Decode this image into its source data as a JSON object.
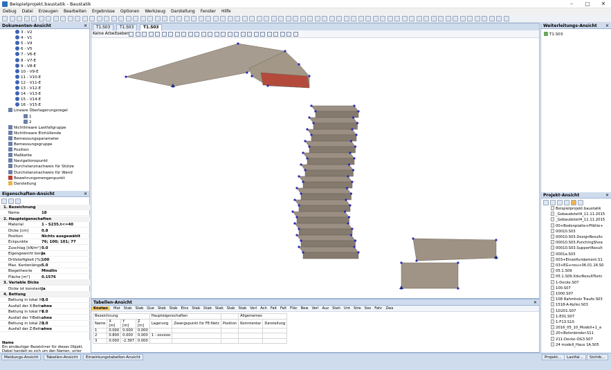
{
  "window": {
    "title": "Beispielprojekt.baustatik - Baustatik"
  },
  "menu": [
    "Debug",
    "Datei",
    "Erzeugen",
    "Bearbeiten",
    "Ergebnisse",
    "Optionen",
    "Werkzeug",
    "Darstellung",
    "Fenster",
    "Hilfe"
  ],
  "doc_panel": {
    "title": "Dokumenten-Ansicht",
    "items": [
      "3 - V2",
      "4 - V1",
      "5 - V4",
      "6 - V5",
      "7 - V6-E",
      "8 - V7-E",
      "9 - V8-E",
      "10 - V9-E",
      "11 - V10-E",
      "12 - V11-E",
      "13 - V12-E",
      "14 - V13-E",
      "15 - V14-E",
      "16 - V15-E",
      "Lineare Überlagerungsregel",
      "1",
      "2",
      "Nichtlineare Lastfallgruppe",
      "Nichtlineare Einhüllende",
      "Bemessungsparameter",
      "Bemessungsgruppe",
      "Position",
      "Maßkette",
      "Navigationspunkt",
      "Durchstanznachweis für Stütze",
      "Durchstanznachweis für Wand",
      "Bewehrungsmengenpunkt",
      "Darstellung"
    ]
  },
  "props_panel": {
    "title": "Eigenschaften-Ansicht",
    "rows": [
      {
        "sec": true,
        "k": "1. Bezeichnung"
      },
      {
        "k": "Name",
        "v": "18"
      },
      {
        "sec": true,
        "k": "2. Haupteigenschaften"
      },
      {
        "k": "Material",
        "v": "1 - S235.t<=40"
      },
      {
        "k": "Dicke [cm]",
        "v": "0.8"
      },
      {
        "k": "Position",
        "v": "Nichts ausgewählt"
      },
      {
        "k": "Eckpunkte",
        "v": "76; 100; 101; 77"
      },
      {
        "k": "Zuschlag [kN/m²]",
        "v": "0.0"
      },
      {
        "k": "Eigengewicht beru",
        "v": "Ja"
      },
      {
        "k": "Drillsteifigkeit [%]",
        "v": "100"
      },
      {
        "k": "Max. Kantenlänge",
        "v": "5.0"
      },
      {
        "k": "Biegetheorie",
        "v": "Mindlin"
      },
      {
        "k": "Fläche [m²]",
        "v": "0.1576"
      },
      {
        "sec": true,
        "k": "3. Variable Dicke"
      },
      {
        "k": "Dicke ist konstant",
        "v": "Ja"
      },
      {
        "sec": true,
        "k": "4. Bettung"
      },
      {
        "k": "Bettung in lokal X [",
        "v": "0.0"
      },
      {
        "k": "Ausfall der X-Bettu",
        "v": "ohne"
      },
      {
        "k": "Bettung in lokal Y [",
        "v": "0.0"
      },
      {
        "k": "Ausfall der Y-Bettu",
        "v": "ohne"
      },
      {
        "k": "Bettung in lokal Z [",
        "v": "0.0"
      },
      {
        "k": "Ausfall der Z-Bettu",
        "v": "ohne"
      }
    ],
    "name_title": "Name",
    "name_desc": "Ein eindeutiger Bezeichner für dieses Objekt. Dabei handelt es sich um den Namen, unter dem das O"
  },
  "viewport": {
    "tabs": [
      "T1.S03",
      "T1.S03",
      "T1.S03"
    ],
    "arbeitsebene": "Keine Arbeitseben ▾"
  },
  "table_panel": {
    "title": "Tabellen-Ansicht",
    "tools": [
      "Knoten",
      "Mat",
      "Stab",
      "Stab",
      "Que",
      "Stab",
      "Stab",
      "Einz",
      "Stab",
      "Stab",
      "Stab",
      "Stab",
      "Stab",
      "Verl",
      "Ach",
      "Falt",
      "Falt",
      "Fläc",
      "Bew",
      "Verl",
      "Auz",
      "Stah",
      "Unt",
      "Stre",
      "Soo",
      "Fahr",
      "Zwa"
    ],
    "group_headers": [
      "Bezeichnung",
      "Haupteigenschaften",
      "Allgemeines"
    ],
    "columns": [
      "Name",
      "X\n[m]",
      "Y\n[m]",
      "Z\n[m]",
      "Lagerung",
      "Zwangspunkt für FE-Netz",
      "Position",
      "Kommentar",
      "Darstellung"
    ],
    "rows": [
      [
        "1",
        "0.000",
        "0.000",
        "0.000",
        "",
        ""
      ],
      [
        "2",
        "0.800",
        "0.000",
        "0.000",
        "1 - oovooo",
        ""
      ],
      [
        "3",
        "0.000",
        "-2.397",
        "0.000",
        "",
        ""
      ]
    ]
  },
  "right_panel": {
    "title": "Weiterleitungs-Ansicht",
    "item": "T1.S03"
  },
  "proj_panel": {
    "title": "Projekt-Ansicht",
    "items": [
      "Beispielprojekt.baustatik",
      "_Gebaudeteil4_11.11.2015",
      "_Gebaudeteil4_11.11.2015",
      "00+Bodenplatte+Pfähle+",
      "00010.S03",
      "00010.S03.DesignResults",
      "00010.S03.PunchingShea",
      "00010.S03.SupportResult",
      "0001a.S03",
      "003+Einzelfundament.S1",
      "03+EG+neu+06.01.16.S0",
      "05.1.S09",
      "05.1.S09.XdurResultTestc",
      "1-Decke.S07",
      "100.S07",
      "1000.S07",
      "108 Rahmholz Traufe.S03",
      "1518-A-Keller.S03",
      "1D201.S07",
      "1-E01.S07",
      "1-F13.S10",
      "2016_05_10_Modell+1_a",
      "20+Betonbinder.S11",
      "211-Decke-OG3.S07",
      "24 modell_Haus 1A.S05"
    ]
  },
  "bottom_tabs": [
    "Meldungs-Ansicht",
    "Tabellen-Ansicht",
    "Einwirkungstabellen-Ansicht"
  ],
  "bottom_right_tabs": [
    "Projekt...",
    "Lastfal...",
    "Sichtb..."
  ]
}
